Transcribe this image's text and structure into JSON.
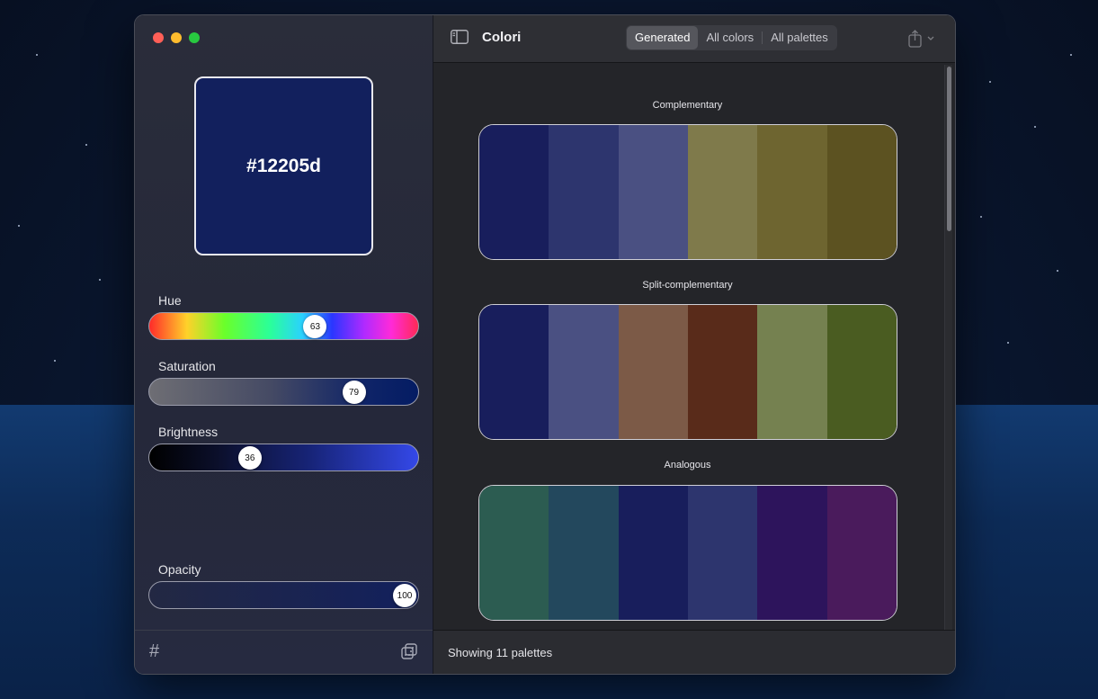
{
  "colors": {
    "current": "#12205d",
    "accent_seg": "#55565c"
  },
  "sidebar": {
    "swatch_hex": "#12205d",
    "sliders": [
      {
        "label": "Hue",
        "value": "63",
        "fraction": 0.63
      },
      {
        "label": "Saturation",
        "value": "79",
        "fraction": 0.79
      },
      {
        "label": "Brightness",
        "value": "36",
        "fraction": 0.36
      },
      {
        "label": "Opacity",
        "value": "100",
        "fraction": 1.0
      }
    ],
    "footer_hash": "#"
  },
  "toolbar": {
    "title": "Colori",
    "tabs": [
      {
        "label": "Generated",
        "active": true
      },
      {
        "label": "All colors",
        "active": false
      },
      {
        "label": "All palettes",
        "active": false
      }
    ]
  },
  "palettes": [
    {
      "name": "Complementary",
      "colors": [
        "#181e5c",
        "#2d356e",
        "#4a5082",
        "#7f7a4b",
        "#6e6530",
        "#5c5221"
      ]
    },
    {
      "name": "Split-complementary",
      "colors": [
        "#181e5c",
        "#4a5082",
        "#7c5a47",
        "#592b1a",
        "#758150",
        "#4a5c21"
      ]
    },
    {
      "name": "Analogous",
      "colors": [
        "#2c5c51",
        "#23485d",
        "#181e5c",
        "#2d356e",
        "#2d145c",
        "#4a1b5c"
      ]
    }
  ],
  "status": {
    "text": "Showing 11 palettes"
  }
}
